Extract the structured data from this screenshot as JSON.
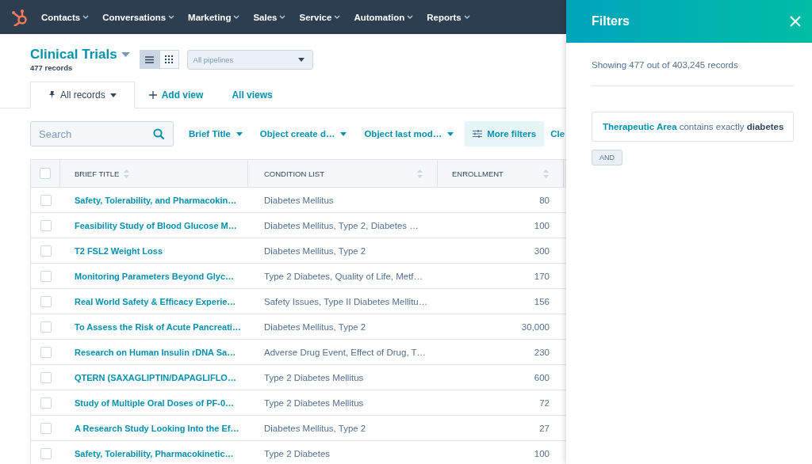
{
  "nav": {
    "items": [
      {
        "label": "Contacts"
      },
      {
        "label": "Conversations"
      },
      {
        "label": "Marketing"
      },
      {
        "label": "Sales"
      },
      {
        "label": "Service"
      },
      {
        "label": "Automation"
      },
      {
        "label": "Reports"
      }
    ]
  },
  "header": {
    "title": "Clinical Trials",
    "count": "477 records",
    "views": [
      {
        "kind": "list",
        "selected": true
      },
      {
        "kind": "grid",
        "selected": false
      }
    ],
    "pipeline": {
      "value": "All pipelines"
    }
  },
  "tabs": [
    {
      "label": "All records",
      "kind": "view",
      "selected": true
    },
    {
      "label": "Add view",
      "kind": "add",
      "selected": false
    },
    {
      "label": "All views",
      "kind": "link",
      "selected": false
    }
  ],
  "filters": {
    "search": {
      "placeholder": "Search"
    },
    "dropdowns": [
      {
        "label": "Brief Title"
      },
      {
        "label": "Object create d…"
      },
      {
        "label": "Object last mod…"
      }
    ],
    "more": "More filters",
    "clear": "Cle"
  },
  "table": {
    "header_checkbox": {
      "checked": false
    },
    "columns": [
      {
        "label": "BRIEF TITLE"
      },
      {
        "label": "CONDITION LIST"
      },
      {
        "label": "ENROLLMENT"
      }
    ],
    "rows": [
      {
        "checked": false,
        "title": "Safety, Tolerability, and Pharmacokin…",
        "conditions": "Diabetes Mellitus",
        "enrollment": "80"
      },
      {
        "checked": false,
        "title": "Feasibility Study of Blood Glucose M…",
        "conditions": "Diabetes Mellitus, Type 2, Diabetes …",
        "enrollment": "100"
      },
      {
        "checked": false,
        "title": "T2 FSL2 Weight Loss",
        "conditions": "Diabetes Mellitus, Type 2",
        "enrollment": "300"
      },
      {
        "checked": false,
        "title": "Monitoring Parameters Beyond Glyc…",
        "conditions": "Type 2 Diabetes, Quality of Life, Metf…",
        "enrollment": "170"
      },
      {
        "checked": false,
        "title": "Real World Safety & Efficacy Experie…",
        "conditions": "Safety Issues, Type II Diabetes Mellitu…",
        "enrollment": "156"
      },
      {
        "checked": false,
        "title": "To Assess the Risk of Acute Pancreati…",
        "conditions": "Diabetes Mellitus, Type 2",
        "enrollment": "30,000"
      },
      {
        "checked": false,
        "title": "Research on Human Insulin rDNA Sa…",
        "conditions": "Adverse Drug Event, Effect of Drug, T…",
        "enrollment": "230"
      },
      {
        "checked": false,
        "title": "QTERN (SAXAGLIPTIN/DAPAGLIFLO…",
        "conditions": "Type 2 Diabetes Mellitus",
        "enrollment": "600"
      },
      {
        "checked": false,
        "title": "Study of Multiple Oral Doses of PF-0…",
        "conditions": "Type 2 Diabetes Mellitus",
        "enrollment": "72"
      },
      {
        "checked": false,
        "title": "A Research Study Looking Into the Ef…",
        "conditions": "Diabetes Mellitus, Type 2",
        "enrollment": "27"
      },
      {
        "checked": false,
        "title": "Safety, Tolerability, Pharmacokinetic…",
        "conditions": "Type 2 Diabetes",
        "enrollment": "100"
      }
    ]
  },
  "panel": {
    "title": "Filters",
    "summary": "Showing 477 out of 403,245 records",
    "conditions": [
      {
        "property": "Therapeutic Area",
        "text": "contains exactly **diabetes**"
      }
    ],
    "joiner": "AND"
  }
}
